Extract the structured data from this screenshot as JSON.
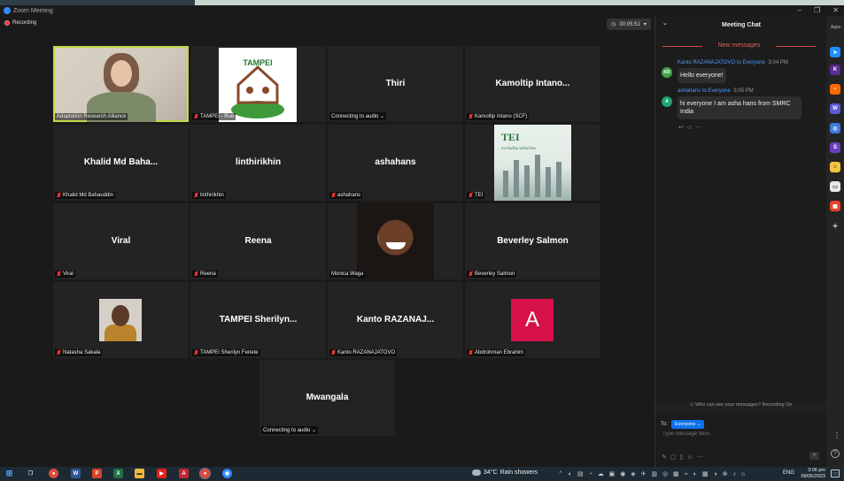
{
  "window": {
    "title": "Zoom Meeting",
    "controls": [
      "–",
      "❐",
      "✕"
    ]
  },
  "recording": {
    "label": "Recording"
  },
  "timer": {
    "value": "00:05:51"
  },
  "tiles": [
    {
      "display": "",
      "label": "Adaptation Research Alliance",
      "mic": false,
      "kind": "video-adapt"
    },
    {
      "display": "",
      "label": "TAMPEI - Rue",
      "mic": true,
      "kind": "tampei-logo"
    },
    {
      "display": "Thiri",
      "label": "Connecting to audio ⌄",
      "mic": false,
      "kind": "name"
    },
    {
      "display": "Kamoltip  Intano...",
      "label": "Kamoltip Intano (SCF)",
      "mic": true,
      "kind": "name"
    },
    {
      "display": "Khalid Md Baha...",
      "label": "Khalid Md Bahauddin",
      "mic": true,
      "kind": "name"
    },
    {
      "display": "linthirikhin",
      "label": "linthirikhin",
      "mic": true,
      "kind": "name"
    },
    {
      "display": "ashahans",
      "label": "ashahans",
      "mic": true,
      "kind": "name"
    },
    {
      "display": "",
      "label": "TEI",
      "mic": true,
      "kind": "tei"
    },
    {
      "display": "Viral",
      "label": "Viral",
      "mic": true,
      "kind": "name"
    },
    {
      "display": "Reena",
      "label": "Reena",
      "mic": true,
      "kind": "name"
    },
    {
      "display": "",
      "label": "Monica Waga",
      "mic": false,
      "kind": "monica"
    },
    {
      "display": "Beverley Salmon",
      "label": "Beverley Salmon",
      "mic": true,
      "kind": "name"
    },
    {
      "display": "",
      "label": "Natasha Sakala",
      "mic": true,
      "kind": "natasha"
    },
    {
      "display": "TAMPEI  Sherilyn...",
      "label": "TAMPEI Sherilyn Fenete",
      "mic": true,
      "kind": "name"
    },
    {
      "display": "Kanto  RAZANAJ...",
      "label": "Kanto RAZANAJATOVO",
      "mic": true,
      "kind": "name"
    },
    {
      "display": "",
      "label": "Abdrohman Ebrahim",
      "mic": true,
      "kind": "avatar-a",
      "avatar_letter": "A"
    },
    {
      "display": "Mwangala",
      "label": "Connecting to audio ⌄",
      "mic": false,
      "kind": "name"
    }
  ],
  "tei_card": {
    "logo": "TEI",
    "tagline": "สถาบันสิ่งแวดล้อมไทย"
  },
  "tampei_logo": {
    "text": "TAMPEI",
    "ring_text": "TECHNICAL ASSISTANCE MOVEMENT FOR PEOPLE AND ENVIRONMENT INC."
  },
  "chat": {
    "title": "Meeting Chat",
    "new_messages": "New messages",
    "messages": [
      {
        "avatar": "KR",
        "avatar_color": "#3fa34d",
        "from": "Kanto RAZANAJATOVO",
        "to": "to Everyone",
        "time": "3:04 PM",
        "text": "Hello everyone!"
      },
      {
        "avatar": "A",
        "avatar_color": "#1fa371",
        "from": "ashahans",
        "to": "to Everyone",
        "time": "3:05 PM",
        "text": "hi everyone I am asha hans from SMRC India"
      }
    ],
    "privacy_note": "Who can see your messages? Recording On",
    "to_label": "To:",
    "recipient": "Everyone ⌄",
    "input_placeholder": "Type message here..."
  },
  "apps_panel": {
    "label": "Apps",
    "icons": [
      {
        "name": "app-arrow-icon",
        "color": "#1f8fff",
        "glyph": "➤"
      },
      {
        "name": "app-kahoot-icon",
        "color": "#5b2d90",
        "glyph": "K"
      },
      {
        "name": "app-orange-icon",
        "color": "#ff6a00",
        "glyph": "▪"
      },
      {
        "name": "app-w-icon",
        "color": "#5b5bd6",
        "glyph": "W"
      },
      {
        "name": "app-swirl-icon",
        "color": "#3c7bd9",
        "glyph": "◎"
      },
      {
        "name": "app-scribe-icon",
        "color": "#6b3fbf",
        "glyph": "S"
      },
      {
        "name": "app-smiley-icon",
        "color": "#f6c343",
        "glyph": "☺"
      },
      {
        "name": "app-white-icon",
        "color": "#e8e8e8",
        "glyph": "▭"
      },
      {
        "name": "app-grid-icon",
        "color": "#e6432a",
        "glyph": "▦"
      }
    ]
  },
  "taskbar": {
    "weather_temp": "34°C",
    "weather_text": "Rain showers",
    "lang": "ENG",
    "time": "3:06 pm",
    "date": "09/05/2023",
    "pinned": [
      {
        "name": "windows-start-icon",
        "color": "#4aa3ff",
        "glyph": "⊞"
      },
      {
        "name": "task-view-icon",
        "color": "#3a4a55",
        "glyph": "❐"
      },
      {
        "name": "chrome-icon",
        "color": "#dd4b39",
        "glyph": "●"
      },
      {
        "name": "word-icon",
        "color": "#2b5797",
        "glyph": "W"
      },
      {
        "name": "powerpoint-icon",
        "color": "#d24726",
        "glyph": "P"
      },
      {
        "name": "excel-icon",
        "color": "#1e7145",
        "glyph": "X"
      },
      {
        "name": "file-explorer-icon",
        "color": "#f3b73a",
        "glyph": "▬"
      },
      {
        "name": "youtube-icon",
        "color": "#e62117",
        "glyph": "▶"
      },
      {
        "name": "acrobat-icon",
        "color": "#c1272d",
        "glyph": "A"
      },
      {
        "name": "chrome-active-icon",
        "color": "#dd4b39",
        "glyph": "●"
      },
      {
        "name": "zoom-icon",
        "color": "#2d8cff",
        "glyph": "◉"
      }
    ]
  }
}
